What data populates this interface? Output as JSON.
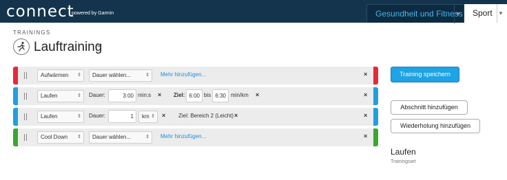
{
  "colors": {
    "warmup": "#e8283a",
    "active": "#1f9fe0",
    "cooldown": "#3aa82f",
    "brand": "#13344c"
  },
  "header": {
    "logo": "connect",
    "powered_by": "powered by Garmin",
    "nav": [
      {
        "label": "Gesundheit und Fitness",
        "caret": "▾"
      },
      {
        "label": "Sport",
        "caret": "▾"
      }
    ]
  },
  "page": {
    "section_label": "TRAININGS",
    "title": "Lauftraining",
    "icon": "running-icon"
  },
  "steps": [
    {
      "type": "Aufwärmen",
      "duration_select": "Dauer wählen...",
      "more_link": "Mehr hinzufügen..."
    },
    {
      "type": "Laufen",
      "duration_label": "Dauer:",
      "duration_value": "3:00",
      "duration_unit": "min:s",
      "target_label": "Ziel:",
      "target_from": "6:00",
      "target_between": "bis",
      "target_to": "6:30",
      "target_unit": "min/km"
    },
    {
      "type": "Laufen",
      "duration_label": "Dauer:",
      "duration_value": "1",
      "duration_unit": "km",
      "target_text": "Ziel: Bereich 2 (Leicht)"
    },
    {
      "type": "Cool Down",
      "duration_select": "Dauer wählen...",
      "more_link": "Mehr hinzufügen..."
    }
  ],
  "sidebar": {
    "save_button": "Training speichern",
    "add_step_button": "Abschnitt hinzufügen",
    "add_repeat_button": "Wiederholung hinzufügen",
    "sport_value": "Laufen",
    "sport_label": "Trainingsart"
  },
  "glyphs": {
    "close": "×",
    "updown": "⇕",
    "pencil": "✎",
    "runner": "🏃"
  }
}
